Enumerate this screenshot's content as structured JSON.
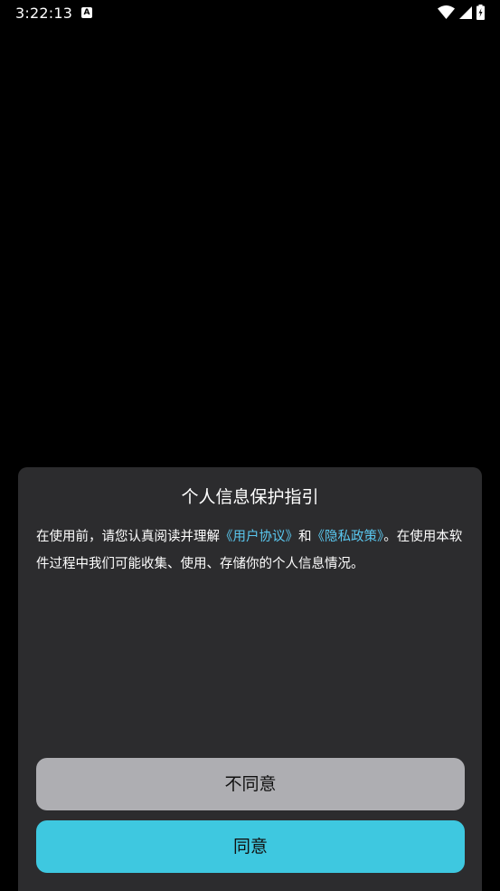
{
  "status_bar": {
    "time": "3:22:13",
    "notification_icon_letter": "A"
  },
  "dialog": {
    "title": "个人信息保护指引",
    "body_prefix": "在使用前，请您认真阅读并理解",
    "user_agreement_link": "《用户协议》",
    "body_and": "和",
    "privacy_policy_link": "《隐私政策》",
    "body_suffix": "。在使用本软件过程中我们可能收集、使用、存储你的个人信息情况。",
    "disagree_label": "不同意",
    "agree_label": "同意"
  },
  "colors": {
    "background": "#000000",
    "dialog_background": "#2c2c2e",
    "link": "#5ac8f0",
    "agree_button": "#3ec8e0",
    "disagree_button": "#aeaeb2"
  }
}
